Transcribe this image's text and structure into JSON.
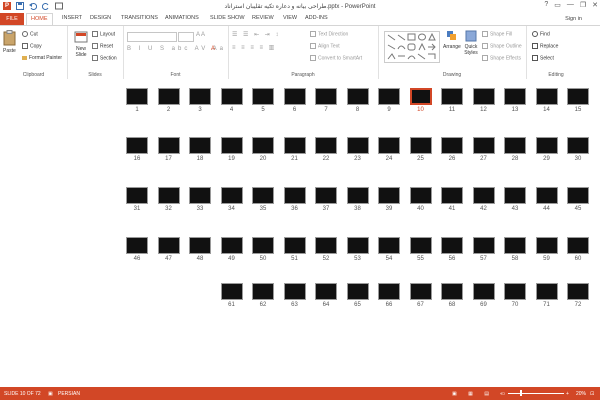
{
  "titlebar": {
    "title": "طراحی بیانه و دعاره تکیه تقلیبان استراناد.pptx - PowerPoint",
    "logo": "P",
    "help": "?",
    "ribbon_opts": "▭",
    "minimize": "—",
    "restore": "❐",
    "close": "✕"
  },
  "tabs": [
    "FILE",
    "HOME",
    "INSERT",
    "DESIGN",
    "TRANSITIONS",
    "ANIMATIONS",
    "SLIDE SHOW",
    "REVIEW",
    "VIEW",
    "ADD-INS"
  ],
  "signin": "Sign in",
  "ribbon": {
    "clipboard": {
      "label": "Clipboard",
      "paste": "Paste",
      "cut": "Cut",
      "copy": "Copy",
      "format_painter": "Format Painter"
    },
    "slides": {
      "label": "Slides",
      "new_slide": "New Slide",
      "layout": "Layout",
      "reset": "Reset",
      "section": "Section"
    },
    "font": {
      "label": "Font"
    },
    "paragraph": {
      "label": "Paragraph",
      "text_direction": "Text Direction",
      "align_text": "Align Text",
      "convert": "Convert to SmartArt"
    },
    "drawing": {
      "label": "Drawing",
      "arrange": "Arrange",
      "quick_styles": "Quick Styles",
      "shape_fill": "Shape Fill",
      "shape_outline": "Shape Outline",
      "shape_effects": "Shape Effects"
    },
    "editing": {
      "label": "Editing",
      "find": "Find",
      "replace": "Replace",
      "select": "Select"
    }
  },
  "slides": {
    "selected": 10,
    "rows": [
      [
        15,
        14,
        13,
        12,
        11,
        10,
        9,
        8,
        7,
        6,
        5,
        4,
        3,
        2,
        1
      ],
      [
        30,
        29,
        28,
        27,
        26,
        25,
        24,
        23,
        22,
        21,
        20,
        19,
        18,
        17,
        16
      ],
      [
        45,
        44,
        43,
        42,
        41,
        40,
        39,
        38,
        37,
        36,
        35,
        34,
        33,
        32,
        31
      ],
      [
        60,
        59,
        58,
        57,
        56,
        55,
        54,
        53,
        52,
        51,
        50,
        49,
        48,
        47,
        46
      ],
      [
        72,
        71,
        70,
        69,
        68,
        67,
        66,
        65,
        64,
        63,
        62,
        61
      ]
    ]
  },
  "status": {
    "slide": "SLIDE 10 OF 72",
    "language": "PERSIAN",
    "zoom": "20%",
    "zoom_minus": "−",
    "zoom_plus": "+"
  },
  "colors": {
    "accent": "#d24726",
    "slide_bg": "#111111"
  }
}
